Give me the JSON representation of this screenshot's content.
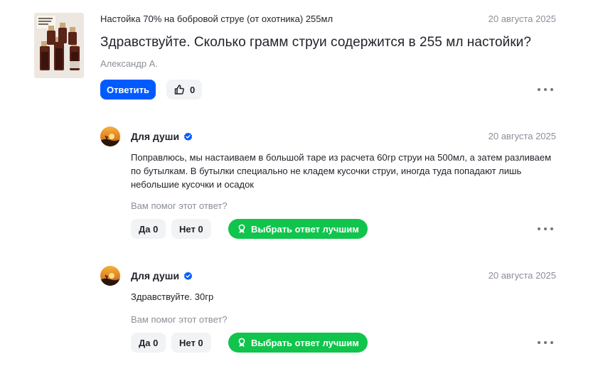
{
  "question": {
    "product_title": "Настойка 70% на бобровой струе (от охотника) 255мл",
    "date": "20 августа 2025",
    "text": "Здравствуйте. Сколько грамм струи содержится в 255 мл настойки?",
    "author": "Александр А.",
    "reply_label": "Ответить",
    "likes": "0",
    "icons": {
      "like": "thumbs-up-icon",
      "more": "more-dots-icon"
    }
  },
  "answers": [
    {
      "author": "Для души",
      "verified_icon": "verified-check-icon",
      "date": "20 августа 2025",
      "text": "Поправлюсь, мы настаиваем в большой таре из расчета 60гр струи на 500мл, а затем разливаем по бутылкам. В бутылки специально не кладем кусочки струи, иногда туда попадают лишь небольшие кусочки и осадок",
      "helpful_prompt": "Вам помог этот ответ?",
      "yes_label": "Да 0",
      "no_label": "Нет 0",
      "best_label": "Выбрать ответ лучшим"
    },
    {
      "author": "Для души",
      "verified_icon": "verified-check-icon",
      "date": "20 августа 2025",
      "text": "Здравствуйте. 30гр",
      "helpful_prompt": "Вам помог этот ответ?",
      "yes_label": "Да 0",
      "no_label": "Нет 0",
      "best_label": "Выбрать ответ лучшим"
    }
  ],
  "colors": {
    "primary": "#005bff",
    "success": "#10c44c",
    "muted_text": "#8a8f99",
    "chip_bg": "#f2f3f5",
    "verified": "#005bff"
  }
}
